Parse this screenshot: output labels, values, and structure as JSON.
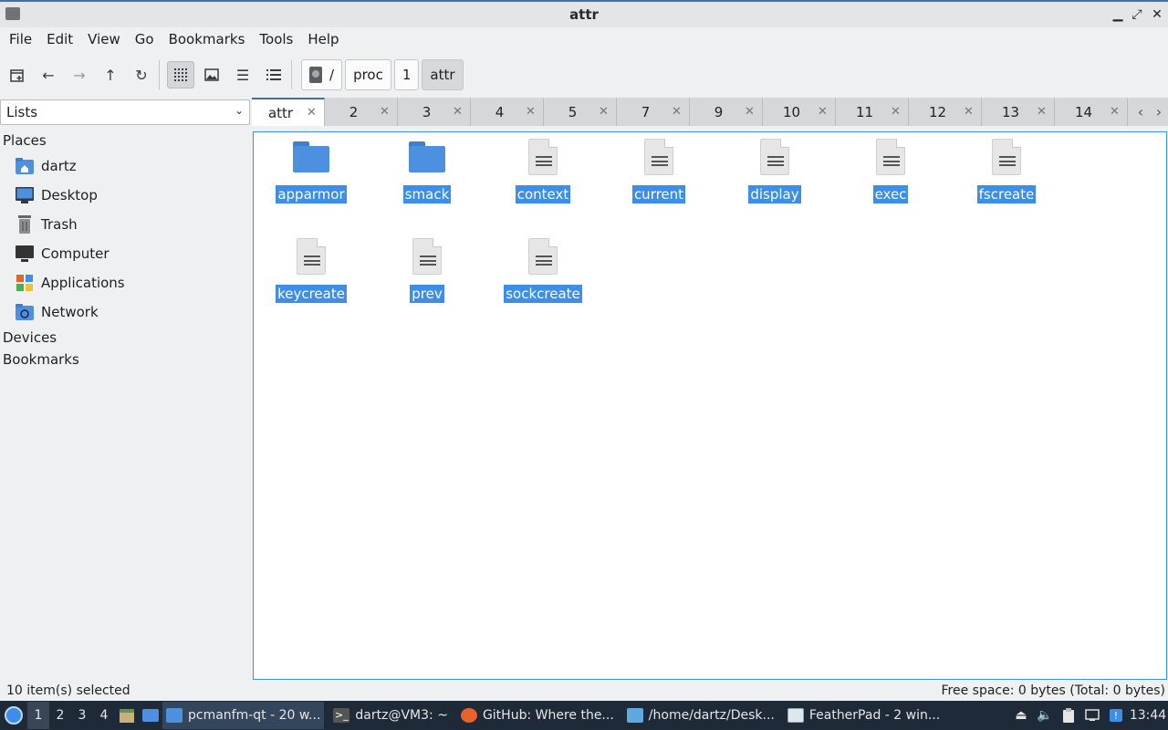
{
  "window": {
    "title": "attr"
  },
  "menu": [
    "File",
    "Edit",
    "View",
    "Go",
    "Bookmarks",
    "Tools",
    "Help"
  ],
  "breadcrumb": [
    "/",
    "proc",
    "1",
    "attr"
  ],
  "side_combo": "Lists",
  "places": {
    "heading": "Places",
    "items": [
      "dartz",
      "Desktop",
      "Trash",
      "Computer",
      "Applications",
      "Network"
    ],
    "devices": "Devices",
    "bookmarks": "Bookmarks"
  },
  "tabs": [
    {
      "label": "attr",
      "active": true
    },
    {
      "label": "2"
    },
    {
      "label": "3"
    },
    {
      "label": "4"
    },
    {
      "label": "5"
    },
    {
      "label": "7"
    },
    {
      "label": "9"
    },
    {
      "label": "10"
    },
    {
      "label": "11"
    },
    {
      "label": "12"
    },
    {
      "label": "13"
    },
    {
      "label": "14"
    }
  ],
  "files": [
    {
      "name": "apparmor",
      "type": "folder"
    },
    {
      "name": "smack",
      "type": "folder"
    },
    {
      "name": "context",
      "type": "file"
    },
    {
      "name": "current",
      "type": "file"
    },
    {
      "name": "display",
      "type": "file"
    },
    {
      "name": "exec",
      "type": "file"
    },
    {
      "name": "fscreate",
      "type": "file"
    },
    {
      "name": "keycreate",
      "type": "file"
    },
    {
      "name": "prev",
      "type": "file"
    },
    {
      "name": "sockcreate",
      "type": "file"
    }
  ],
  "status": {
    "left": "10 item(s) selected",
    "right": "Free space: 0 bytes (Total: 0 bytes)"
  },
  "taskbar": {
    "desktops": [
      "1",
      "2",
      "3",
      "4"
    ],
    "tasks": [
      {
        "label": "pcmanfm-qt - 20 w...",
        "active": true
      },
      {
        "label": "dartz@VM3: ~"
      },
      {
        "label": "GitHub: Where the..."
      },
      {
        "label": "/home/dartz/Desk..."
      },
      {
        "label": "FeatherPad - 2 win..."
      }
    ],
    "clock": "13:44"
  },
  "colors": {
    "accent": "#3d8ee8",
    "taskbar": "#1f2a38"
  }
}
